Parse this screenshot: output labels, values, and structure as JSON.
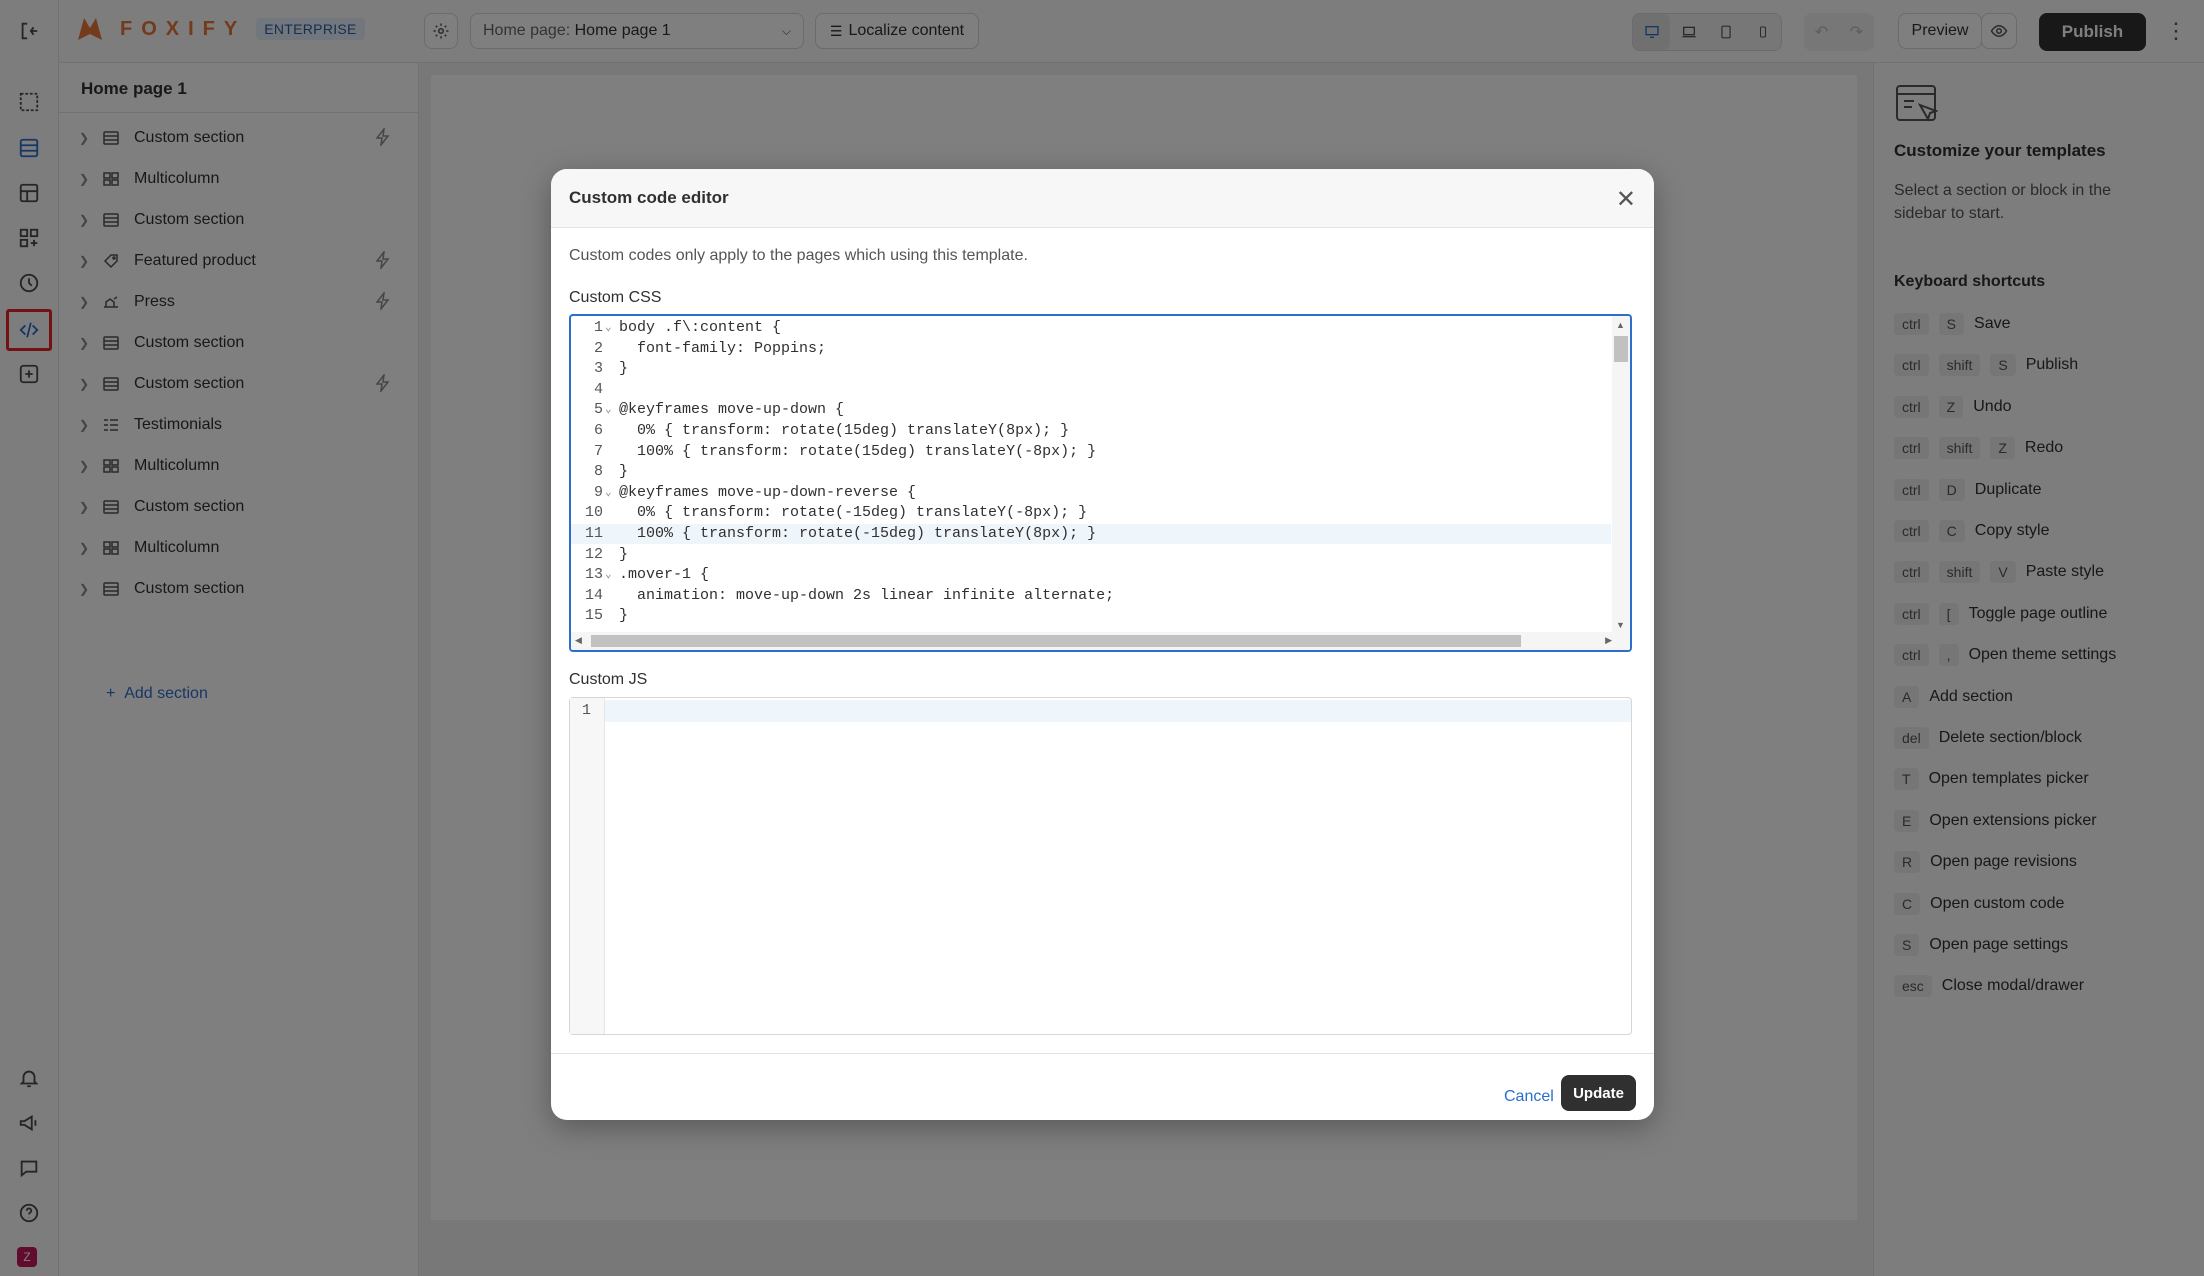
{
  "topbar": {
    "logo_text": "FOXIFY",
    "badge": "ENTERPRISE",
    "page_select_label": "Home page:",
    "page_select_value": "Home page 1",
    "localize_label": "Localize content",
    "preview_label": "Preview",
    "publish_label": "Publish"
  },
  "left_panel": {
    "title": "Home page 1",
    "sections": [
      {
        "name": "Custom section",
        "icon": "section-icon",
        "bolt": true
      },
      {
        "name": "Multicolumn",
        "icon": "multicolumn-icon",
        "bolt": false
      },
      {
        "name": "Custom section",
        "icon": "section-icon",
        "bolt": false
      },
      {
        "name": "Featured product",
        "icon": "tag-icon",
        "bolt": true
      },
      {
        "name": "Press",
        "icon": "press-icon",
        "bolt": true
      },
      {
        "name": "Custom section",
        "icon": "section-icon",
        "bolt": false
      },
      {
        "name": "Custom section",
        "icon": "section-icon",
        "bolt": true
      },
      {
        "name": "Testimonials",
        "icon": "testimonials-icon",
        "bolt": false
      },
      {
        "name": "Multicolumn",
        "icon": "multicolumn-icon",
        "bolt": false
      },
      {
        "name": "Custom section",
        "icon": "section-icon",
        "bolt": false
      },
      {
        "name": "Multicolumn",
        "icon": "multicolumn-icon",
        "bolt": false
      },
      {
        "name": "Custom section",
        "icon": "section-icon",
        "bolt": false
      }
    ],
    "add_section": "Add section"
  },
  "right_panel": {
    "title": "Customize your templates",
    "description": "Select a section or block in the sidebar to start.",
    "shortcuts_title": "Keyboard shortcuts",
    "shortcuts": [
      {
        "keys": [
          "ctrl",
          "S"
        ],
        "label": "Save"
      },
      {
        "keys": [
          "ctrl",
          "shift",
          "S"
        ],
        "label": "Publish"
      },
      {
        "keys": [
          "ctrl",
          "Z"
        ],
        "label": "Undo"
      },
      {
        "keys": [
          "ctrl",
          "shift",
          "Z"
        ],
        "label": "Redo"
      },
      {
        "keys": [
          "ctrl",
          "D"
        ],
        "label": "Duplicate"
      },
      {
        "keys": [
          "ctrl",
          "C"
        ],
        "label": "Copy style"
      },
      {
        "keys": [
          "ctrl",
          "shift",
          "V"
        ],
        "label": "Paste style"
      },
      {
        "keys": [
          "ctrl",
          "["
        ],
        "label": "Toggle page outline"
      },
      {
        "keys": [
          "ctrl",
          ","
        ],
        "label": "Open theme settings"
      },
      {
        "keys": [
          "A"
        ],
        "label": "Add section"
      },
      {
        "keys": [
          "del"
        ],
        "label": "Delete section/block"
      },
      {
        "keys": [
          "T"
        ],
        "label": "Open templates picker"
      },
      {
        "keys": [
          "E"
        ],
        "label": "Open extensions picker"
      },
      {
        "keys": [
          "R"
        ],
        "label": "Open page revisions"
      },
      {
        "keys": [
          "C"
        ],
        "label": "Open custom code"
      },
      {
        "keys": [
          "S"
        ],
        "label": "Open page settings"
      },
      {
        "keys": [
          "esc"
        ],
        "label": "Close modal/drawer"
      }
    ]
  },
  "modal": {
    "title": "Custom code editor",
    "note": "Custom codes only apply to the pages which using this template.",
    "css_label": "Custom CSS",
    "css_lines": [
      "body .f\\:content {",
      "  font-family: Poppins;",
      "}",
      "",
      "@keyframes move-up-down {",
      "  0% { transform: rotate(15deg) translateY(8px); }",
      "  100% { transform: rotate(15deg) translateY(-8px); }",
      "}",
      "@keyframes move-up-down-reverse {",
      "  0% { transform: rotate(-15deg) translateY(-8px); }",
      "  100% { transform: rotate(-15deg) translateY(8px); }",
      "}",
      ".mover-1 {",
      "  animation: move-up-down 2s linear infinite alternate;",
      "}"
    ],
    "fold_lines": [
      1,
      5,
      9,
      13
    ],
    "current_line": 11,
    "js_label": "Custom JS",
    "js_line_number": "1",
    "cancel_label": "Cancel",
    "update_label": "Update"
  },
  "colors": {
    "accent": "#2c6ecb",
    "highlight_border": "#e4242a",
    "logo": "#e8743b"
  }
}
